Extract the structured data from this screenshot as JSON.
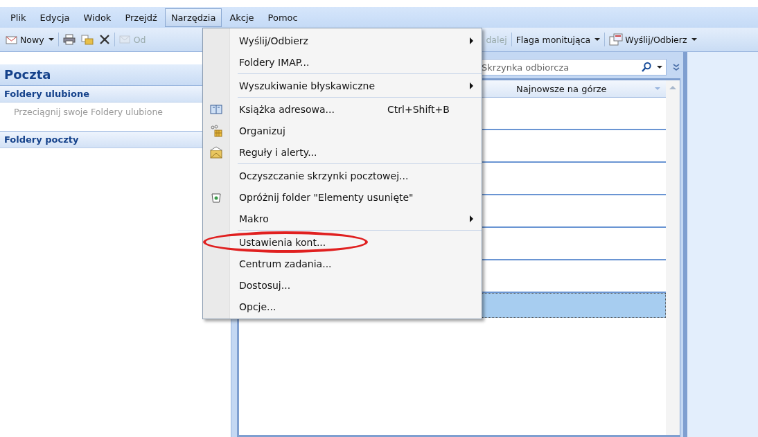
{
  "menubar": [
    {
      "label": "Plik",
      "selected": false
    },
    {
      "label": "Edycja",
      "selected": false
    },
    {
      "label": "Widok",
      "selected": false
    },
    {
      "label": "Przejdź",
      "selected": false
    },
    {
      "label": "Narzędzia",
      "selected": true
    },
    {
      "label": "Akcje",
      "selected": false
    },
    {
      "label": "Pomoc",
      "selected": false
    }
  ],
  "toolbar_left": [
    {
      "kind": "new",
      "label": "Nowy",
      "dropdown": true,
      "disabled": false
    },
    {
      "kind": "print",
      "disabled": false
    },
    {
      "kind": "move",
      "disabled": false
    },
    {
      "kind": "delete",
      "disabled": false
    },
    {
      "kind": "reply",
      "label": "Od",
      "disabled": true
    }
  ],
  "toolbar_right": [
    {
      "kind": "forward",
      "label": "dalej",
      "disabled": true,
      "dropdown": false
    },
    {
      "kind": "flag",
      "label": "Flaga monitująca",
      "dropdown": true,
      "disabled": false
    },
    {
      "kind": "sendreceive",
      "label": "Wyślij/Odbierz",
      "dropdown": true,
      "disabled": false
    }
  ],
  "navigation": {
    "title": "Poczta",
    "sections": [
      {
        "title": "Foldery ulubione",
        "hint": "Przeciągnij swoje Foldery ulubione"
      },
      {
        "title": "Foldery poczty"
      }
    ]
  },
  "message_list": {
    "search": {
      "placeholder": "Skrzynka odbiorcza"
    },
    "sort_label": "Najnowsze na górze",
    "rows": [
      {
        "selected": false
      },
      {
        "selected": false
      },
      {
        "selected": false
      },
      {
        "selected": false
      },
      {
        "selected": false
      },
      {
        "selected": false
      },
      {
        "selected": true
      }
    ]
  },
  "tools_menu": [
    {
      "kind": "item",
      "label": "Wyślij/Odbierz",
      "submenu": true
    },
    {
      "kind": "item",
      "label": "Foldery IMAP..."
    },
    {
      "kind": "separator"
    },
    {
      "kind": "item",
      "label": "Wyszukiwanie błyskawiczne",
      "submenu": true
    },
    {
      "kind": "separator"
    },
    {
      "kind": "book",
      "label": "Książka adresowa...",
      "shortcut": "Ctrl+Shift+B"
    },
    {
      "kind": "organize",
      "label": "Organizuj"
    },
    {
      "kind": "rules",
      "label": "Reguły i alerty..."
    },
    {
      "kind": "separator"
    },
    {
      "kind": "item",
      "label": "Oczyszczanie skrzynki pocztowej..."
    },
    {
      "kind": "bin",
      "label": "Opróżnij folder \"Elementy usunięte\""
    },
    {
      "kind": "item",
      "label": "Makro",
      "submenu": true
    },
    {
      "kind": "separator"
    },
    {
      "kind": "item",
      "label": "Ustawienia kont...",
      "circled": true
    },
    {
      "kind": "item",
      "label": "Centrum zadania..."
    },
    {
      "kind": "item",
      "label": "Dostosuj..."
    },
    {
      "kind": "item",
      "label": "Opcje..."
    }
  ]
}
